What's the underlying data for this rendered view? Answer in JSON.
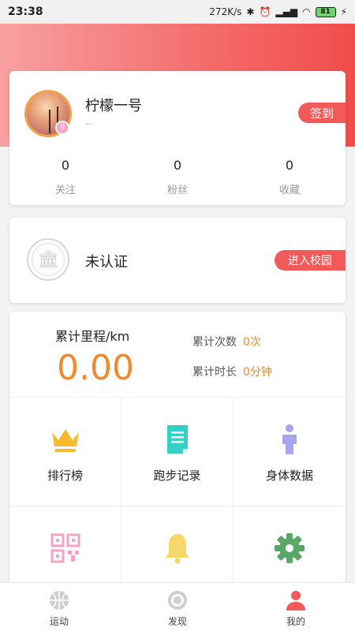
{
  "status": {
    "time": "23:38",
    "network": "272K/s",
    "battery": "81"
  },
  "profile": {
    "name": "柠檬一号",
    "sub": "--",
    "sign_label": "签到",
    "stats": [
      {
        "value": "0",
        "label": "关注"
      },
      {
        "value": "0",
        "label": "粉丝"
      },
      {
        "value": "0",
        "label": "收藏"
      }
    ]
  },
  "auth": {
    "status": "未认证",
    "button": "进入校园"
  },
  "summary": {
    "mileage_label": "累计里程/km",
    "mileage_value": "0.00",
    "count_label": "累计次数",
    "count_value": "0次",
    "time_label": "累计时长",
    "time_value": "0分钟"
  },
  "grid": [
    {
      "label": "排行榜",
      "icon": "crown-icon"
    },
    {
      "label": "跑步记录",
      "icon": "document-icon"
    },
    {
      "label": "身体数据",
      "icon": "person-icon"
    },
    {
      "label": "",
      "icon": "qr-code-icon"
    },
    {
      "label": "",
      "icon": "bell-icon"
    },
    {
      "label": "",
      "icon": "settings-gear-icon"
    }
  ],
  "tabs": [
    {
      "label": "运动",
      "icon": "basketball-icon"
    },
    {
      "label": "发现",
      "icon": "target-icon"
    },
    {
      "label": "我的",
      "icon": "user-icon"
    }
  ],
  "colors": {
    "accent": "#f25a5a",
    "highlight": "#f08a2c"
  }
}
